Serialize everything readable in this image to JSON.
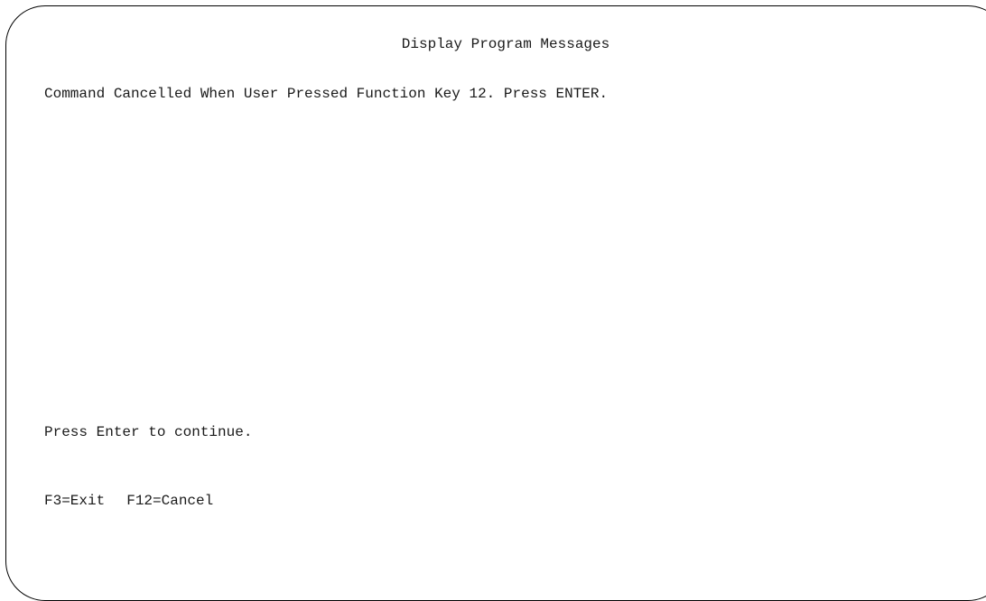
{
  "screen": {
    "title": "Display Program Messages",
    "message": "Command Cancelled When User Pressed Function Key 12. Press ENTER.",
    "prompt": "Press Enter to continue."
  },
  "function_keys": [
    {
      "label": "F3=Exit"
    },
    {
      "label": "F12=Cancel"
    }
  ]
}
